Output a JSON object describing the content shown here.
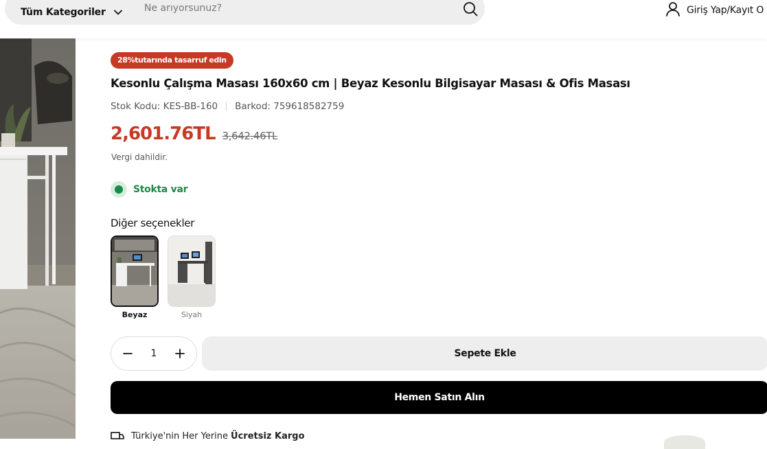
{
  "header": {
    "categories_label": "Tüm Kategoriler",
    "search_placeholder": "Ne arıyorsunuz?",
    "login_label": "Giriş Yap/Kayıt O"
  },
  "product": {
    "savings_badge": "28%tutarında tasarruf edin",
    "title": "Kesonlu Çalışma Masası 160x60 cm | Beyaz Kesonlu Bilgisayar Masası & Ofis Masası",
    "stock_code": "Stok Kodu: KES-BB-160",
    "barcode": "Barkod: 759618582759",
    "price": "2,601.76TL",
    "old_price": "3,642.46TL",
    "tax_note": "Vergi dahildir.",
    "stock_status": "Stokta var",
    "options_title": "Diğer seçenekler",
    "options": [
      {
        "label": "Beyaz",
        "selected": true
      },
      {
        "label": "Siyah",
        "selected": false
      }
    ],
    "quantity": "1",
    "add_to_cart": "Sepete Ekle",
    "buy_now": "Hemen Satın Alın",
    "shipping_text": "Türkiye'nin Her Yerine",
    "shipping_bold": "Ücretsiz Kargo"
  },
  "colors": {
    "accent_red": "#c63a24",
    "stock_green": "#1a8a4a",
    "button_black": "#000000",
    "button_gray": "#eeeeee"
  },
  "icons": [
    "chevron-down-icon",
    "search-icon",
    "user-icon",
    "minus-icon",
    "plus-icon",
    "truck-icon"
  ]
}
